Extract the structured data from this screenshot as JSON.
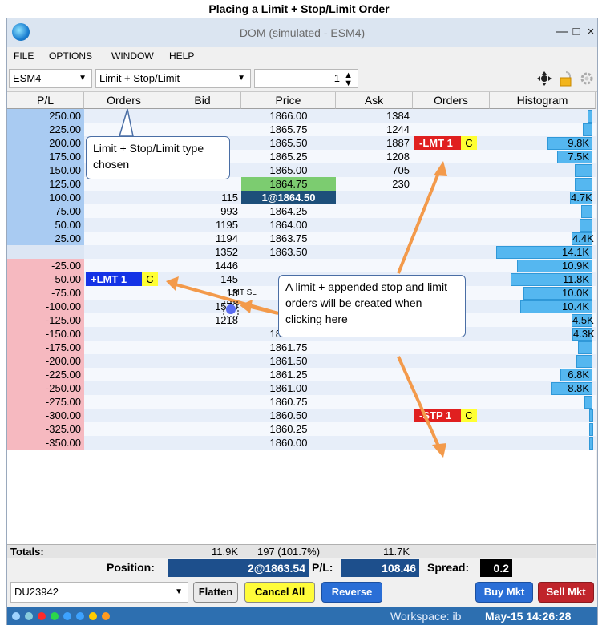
{
  "page_title": "Placing a Limit + Stop/Limit Order",
  "window": {
    "title": "DOM (simulated - ESM4)",
    "minimize": "—",
    "maximize": "□",
    "close": "×"
  },
  "menu": [
    "FILE",
    "OPTIONS",
    "WINDOW",
    "HELP"
  ],
  "toolbar": {
    "symbol": "ESM4",
    "order_type": "Limit + Stop/Limit",
    "quantity": "1"
  },
  "columns": [
    "P/L",
    "Orders",
    "Bid",
    "Price",
    "Ask",
    "Orders",
    "Histogram"
  ],
  "rows": [
    {
      "pl": "250.00",
      "bid": "",
      "price": "1866.00",
      "ask": "1384",
      "hist": ""
    },
    {
      "pl": "225.00",
      "bid": "",
      "price": "1865.75",
      "ask": "1244",
      "hist": ""
    },
    {
      "pl": "200.00",
      "bid": "",
      "price": "1865.50",
      "ask": "1887",
      "hist": "9.8K"
    },
    {
      "pl": "175.00",
      "bid": "",
      "price": "1865.25",
      "ask": "1208",
      "hist": "7.5K"
    },
    {
      "pl": "150.00",
      "bid": "",
      "price": "1865.00",
      "ask": "705",
      "hist": ""
    },
    {
      "pl": "125.00",
      "bid": "",
      "price": "1864.75",
      "ask": "230",
      "hist": ""
    },
    {
      "pl": "100.00",
      "bid": "115",
      "price": "1@1864.50",
      "ask": "",
      "hist": "4.7K"
    },
    {
      "pl": "75.00",
      "bid": "993",
      "price": "1864.25",
      "ask": "",
      "hist": ""
    },
    {
      "pl": "50.00",
      "bid": "1195",
      "price": "1864.00",
      "ask": "",
      "hist": ""
    },
    {
      "pl": "25.00",
      "bid": "1194",
      "price": "1863.75",
      "ask": "",
      "hist": "4.4K"
    },
    {
      "pl": "",
      "bid": "1352",
      "price": "1863.50",
      "ask": "",
      "hist": "14.1K"
    },
    {
      "pl": "-25.00",
      "bid": "1446",
      "price": "",
      "ask": "",
      "hist": "10.9K"
    },
    {
      "pl": "-50.00",
      "bid": "145",
      "price": "",
      "ask": "",
      "hist": "11.8K"
    },
    {
      "pl": "-75.00",
      "bid": "13",
      "price": "",
      "ask": "",
      "hist": "10.0K"
    },
    {
      "pl": "-100.00",
      "bid": "1570",
      "price": "",
      "ask": "",
      "hist": "10.4K"
    },
    {
      "pl": "-125.00",
      "bid": "1218",
      "price": "",
      "ask": "",
      "hist": "4.5K"
    },
    {
      "pl": "-150.00",
      "bid": "",
      "price": "1862.00",
      "ask": "",
      "hist": "4.3K"
    },
    {
      "pl": "-175.00",
      "bid": "",
      "price": "1861.75",
      "ask": "",
      "hist": ""
    },
    {
      "pl": "-200.00",
      "bid": "",
      "price": "1861.50",
      "ask": "",
      "hist": ""
    },
    {
      "pl": "-225.00",
      "bid": "",
      "price": "1861.25",
      "ask": "",
      "hist": "6.8K"
    },
    {
      "pl": "-250.00",
      "bid": "",
      "price": "1861.00",
      "ask": "",
      "hist": "8.8K"
    },
    {
      "pl": "-275.00",
      "bid": "",
      "price": "1860.75",
      "ask": "",
      "hist": ""
    },
    {
      "pl": "-300.00",
      "bid": "",
      "price": "1860.50",
      "ask": "",
      "hist": ""
    },
    {
      "pl": "-325.00",
      "bid": "",
      "price": "1860.25",
      "ask": "",
      "hist": ""
    },
    {
      "pl": "-350.00",
      "bid": "",
      "price": "1860.00",
      "ask": "",
      "hist": ""
    }
  ],
  "orders": {
    "sell_limit": {
      "label": "-LMT 1",
      "c": "C"
    },
    "buy_limit": {
      "label": "+LMT 1",
      "c": "C"
    },
    "sell_stop": {
      "label": "-STP 1",
      "c": "C"
    },
    "hover_label": "LMT SL"
  },
  "callouts": {
    "type_chosen": "Limit + Stop/Limit type chosen",
    "click_here": "A limit + appended stop and limit orders will be created when clicking here"
  },
  "totals": {
    "label": "Totals:",
    "bid": "11.9K",
    "price": "197 (101.7%)",
    "ask": "11.7K"
  },
  "position_bar": {
    "position_label": "Position:",
    "position_value": "2@1863.54",
    "pl_label": "P/L:",
    "pl_value": "108.46",
    "spread_label": "Spread:",
    "spread_value": "0.2"
  },
  "bottom": {
    "account": "DU23942",
    "flatten": "Flatten",
    "cancel_all": "Cancel All",
    "reverse": "Reverse",
    "buy_mkt": "Buy Mkt",
    "sell_mkt": "Sell Mkt"
  },
  "status": {
    "workspace": "Workspace: ib",
    "datetime": "May-15 14:26:28"
  },
  "colors": {
    "pl_positive": "#a9cbf2",
    "pl_negative": "#f6b9c0",
    "price_green": "#7ccc70",
    "last_price": "#1d4f7a",
    "sell_order": "#e02020",
    "buy_order": "#1433e6",
    "arrow": "#f39a4b"
  }
}
